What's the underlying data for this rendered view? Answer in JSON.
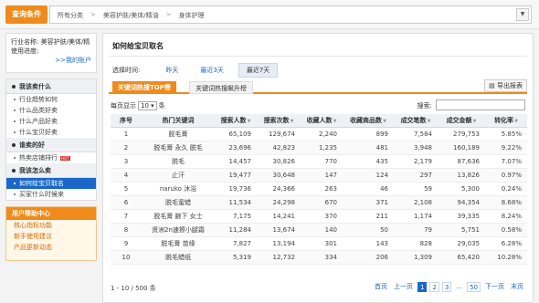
{
  "header": {
    "query_label": "查询条件",
    "crumbs": [
      "所有分类",
      "美容护肤/美体/精油",
      "身体护理"
    ],
    "dropdown_icon": "chevron-down-icon"
  },
  "sidebar": {
    "shop_name": "行业名称: 美容护肤/美体/精",
    "shop_status": "使用进度:",
    "shop_link": ">>我的账户",
    "sections": [
      {
        "title": "我该卖什么",
        "items": [
          "行业趋势如何",
          "什么品类好卖",
          "什么产品好卖",
          "什么宝贝好卖"
        ]
      },
      {
        "title": "谁卖的好",
        "items": [
          "热卖店铺排行"
        ]
      },
      {
        "title": "我该怎么卖",
        "items": [
          "如何给宝贝取名",
          "买家什么时候来"
        ]
      }
    ],
    "hot_badge": "HOT",
    "help_title": "用户帮助中心",
    "help_items": [
      "核心指标功能",
      "新手使用建议",
      "产品更新动态"
    ]
  },
  "main": {
    "title": "如何给宝贝取名",
    "time_label": "选择时间:",
    "time_options": [
      "昨天",
      "最近3天",
      "最近7天"
    ],
    "tab1": "关键词热搜TOP榜",
    "tab2": "关键词热搜飙升榜",
    "export_label": "导出报表",
    "perpage_label": "每页显示",
    "perpage_value": "10",
    "perpage_unit": "条",
    "search_label": "搜索:",
    "search_value": "",
    "columns": [
      "序号",
      "热门关键词",
      "搜索人数",
      "搜索次数",
      "收藏人数",
      "收藏商品数",
      "成交笔数",
      "成交金额",
      "转化率"
    ],
    "rows": [
      [
        "1",
        "脱毛膏",
        "65,109",
        "129,674",
        "2,240",
        "899",
        "7,584",
        "279,753",
        "5.85%"
      ],
      [
        "2",
        "脱毛膏 永久 脱毛",
        "23,696",
        "42,823",
        "1,235",
        "481",
        "3,948",
        "160,189",
        "9.22%"
      ],
      [
        "3",
        "脱毛",
        "14,457",
        "30,826",
        "770",
        "435",
        "2,179",
        "87,636",
        "7.07%"
      ],
      [
        "4",
        "止汗",
        "19,477",
        "30,648",
        "147",
        "124",
        "297",
        "13,826",
        "0.97%"
      ],
      [
        "5",
        "naruko 沐浴",
        "19,736",
        "24,366",
        "263",
        "46",
        "59",
        "5,300",
        "0.24%"
      ],
      [
        "6",
        "脱毛蜜蜡",
        "11,534",
        "24,298",
        "670",
        "371",
        "2,108",
        "94,354",
        "8.68%"
      ],
      [
        "7",
        "脱毛膏 腋下 女士",
        "7,175",
        "14,241",
        "370",
        "211",
        "1,174",
        "39,335",
        "8.24%"
      ],
      [
        "8",
        "贤洲2n速擦小腿霜",
        "11,284",
        "13,674",
        "140",
        "50",
        "79",
        "5,751",
        "0.58%"
      ],
      [
        "9",
        "脱毛膏 苗缘",
        "7,827",
        "13,194",
        "301",
        "143",
        "828",
        "29,035",
        "6.28%"
      ],
      [
        "10",
        "脱毛蜡纸",
        "5,319",
        "12,732",
        "334",
        "206",
        "1,309",
        "65,420",
        "10.28%"
      ]
    ],
    "total": "1 - 10 / 500 条",
    "pager": {
      "first": "首页",
      "prev": "上一页",
      "pages": [
        "1",
        "2",
        "3",
        "...",
        "50"
      ],
      "next": "下一页",
      "last": "末页"
    }
  },
  "colors": {
    "accent": "#f08a1a",
    "link": "#1a67c9"
  }
}
